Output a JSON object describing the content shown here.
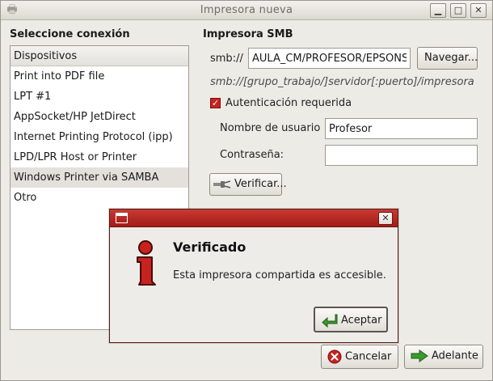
{
  "window": {
    "title": "Impresora nueva",
    "minimize": "▁",
    "maximize": "□",
    "close": "✕"
  },
  "left_panel": {
    "title": "Seleccione conexión",
    "header": "Dispositivos",
    "items": [
      "Print into PDF file",
      "LPT #1",
      "AppSocket/HP JetDirect",
      "Internet Printing Protocol (ipp)",
      "LPD/LPR Host or Printer",
      "Windows Printer via SAMBA",
      "Otro"
    ],
    "selected": "Windows Printer via SAMBA"
  },
  "smb": {
    "title": "Impresora SMB",
    "prefix": "smb://",
    "path_value": "AULA_CM/PROFESOR/EPSONSt",
    "browse_label": "Navegar...",
    "hint": "smb://[grupo_trabajo/]servidor[:puerto]/impresora",
    "auth_label": "Autenticación requerida",
    "auth_checked": true,
    "username_label": "Nombre de usuario",
    "username_value": "Profesor",
    "password_label": "Contraseña:",
    "password_value": "",
    "verify_label": "Verificar..."
  },
  "footer": {
    "cancel_label": "Cancelar",
    "next_label": "Adelante"
  },
  "dialog": {
    "heading": "Verificado",
    "message": "Esta impresora compartida es accesible.",
    "accept_label": "Aceptar",
    "close": "✕"
  },
  "colors": {
    "accent_red": "#c8221f",
    "dialog_titlebar": "#b22a23",
    "ok_green": "#3a9a2e"
  }
}
